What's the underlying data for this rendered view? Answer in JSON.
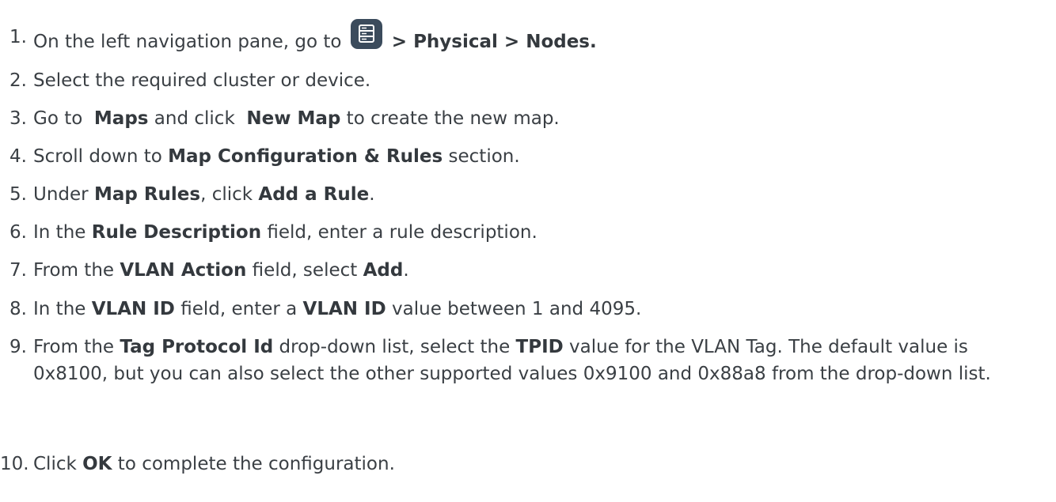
{
  "steps": [
    {
      "num": "1.",
      "before": "On the left navigation pane, go to ",
      "icon": "server-icon",
      "after_bold": " > Physical > Nodes."
    },
    {
      "num": "2.",
      "text": "Select the required cluster or device."
    },
    {
      "num": "3.",
      "t1": "Go to  ",
      "b1": "Maps",
      "t2": " and click  ",
      "b2": "New Map",
      "t3": " to create the new map."
    },
    {
      "num": "4.",
      "t1": "Scroll down to ",
      "b1": "Map Configuration & Rules",
      "t2": " section."
    },
    {
      "num": "5.",
      "t1": "Under ",
      "b1": "Map Rules",
      "t2": ", click ",
      "b2": "Add a Rule",
      "t3": "."
    },
    {
      "num": "6.",
      "t1": "In the ",
      "b1": "Rule Description",
      "t2": " field, enter a rule description."
    },
    {
      "num": "7.",
      "t1": "From the ",
      "b1": "VLAN Action",
      "t2": " field, select ",
      "b2": "Add",
      "t3": "."
    },
    {
      "num": "8.",
      "t1": "In the ",
      "b1": "VLAN ID",
      "t2": " field, enter a ",
      "b2": "VLAN ID",
      "t3": " value between 1 and 4095."
    },
    {
      "num": "9.",
      "t1": "From the ",
      "b1": "Tag Protocol Id",
      "t2": " drop-down list, select the ",
      "b2": "TPID",
      "t3": " value for the VLAN Tag. The default value is 0x8100, but you can also select the other supported values 0x9100 and 0x88a8 from the drop-down list."
    },
    {
      "num": "10.",
      "t1": "Click ",
      "b1": "OK",
      "t2": " to complete the configuration."
    }
  ]
}
